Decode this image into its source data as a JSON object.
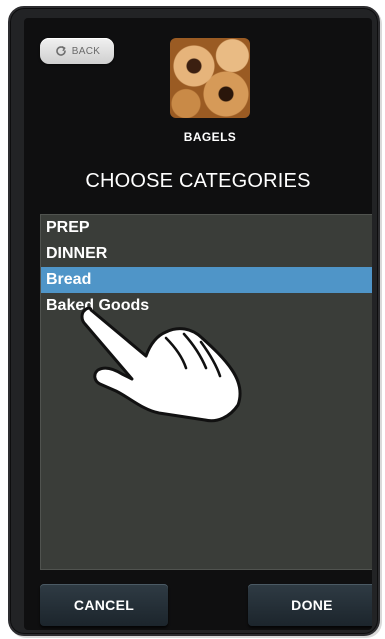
{
  "header": {
    "back_label": "BACK",
    "back_icon": "refresh-arrow-icon",
    "item_title": "BAGELS"
  },
  "main": {
    "heading": "CHOOSE CATEGORIES",
    "categories": [
      {
        "label": "PREP",
        "selected": false
      },
      {
        "label": "DINNER",
        "selected": false
      },
      {
        "label": "Bread",
        "selected": true
      },
      {
        "label": "Baked Goods",
        "selected": false
      }
    ]
  },
  "footer": {
    "cancel_label": "CANCEL",
    "done_label": "DONE"
  },
  "colors": {
    "selected_row": "#4f95c8",
    "list_bg": "#3a3d39",
    "button_bg": "#2b3740"
  }
}
